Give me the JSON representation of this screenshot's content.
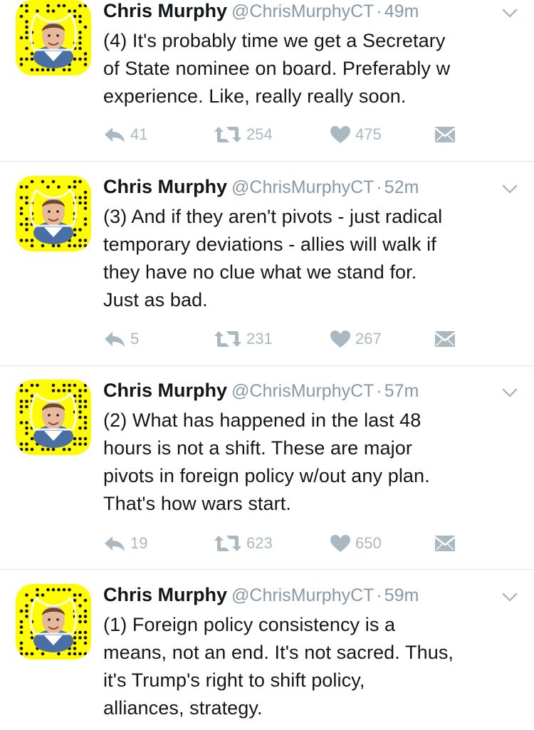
{
  "tweets": [
    {
      "name": "Chris Murphy",
      "handle": "@ChrisMurphyCT",
      "separator": "·",
      "time": "49m",
      "text": "(4) It's probably time we get a Secretary\nof State nominee on board. Preferably w\nexperience. Like, really really soon.",
      "replies": "41",
      "retweets": "254",
      "likes": "475"
    },
    {
      "name": "Chris Murphy",
      "handle": "@ChrisMurphyCT",
      "separator": "·",
      "time": "52m",
      "text": "(3) And if they aren't pivots - just radical\ntemporary deviations - allies will walk if\nthey have no clue what we stand for.\nJust as bad.",
      "replies": "5",
      "retweets": "231",
      "likes": "267"
    },
    {
      "name": "Chris Murphy",
      "handle": "@ChrisMurphyCT",
      "separator": "·",
      "time": "57m",
      "text": "(2) What has happened in the last 48\nhours is not a shift. These are major\npivots in foreign policy w/out any plan.\nThat's how wars start.",
      "replies": "19",
      "retweets": "623",
      "likes": "650"
    },
    {
      "name": "Chris Murphy",
      "handle": "@ChrisMurphyCT",
      "separator": "·",
      "time": "59m",
      "text": "(1) Foreign policy consistency is a\nmeans, not an end. It's not sacred. Thus,\nit's Trump's right to shift policy,\nalliances, strategy.",
      "replies": "",
      "retweets": "",
      "likes": ""
    }
  ],
  "colors": {
    "avatar_bg": "#fffc00",
    "meta_gray": "#8899a6",
    "icon_gray": "#aab8c2",
    "divider": "#e1e8ed"
  },
  "icons": [
    "reply-icon",
    "retweet-icon",
    "like-icon",
    "direct-message-icon",
    "chevron-down-icon",
    "snapcode-avatar"
  ]
}
